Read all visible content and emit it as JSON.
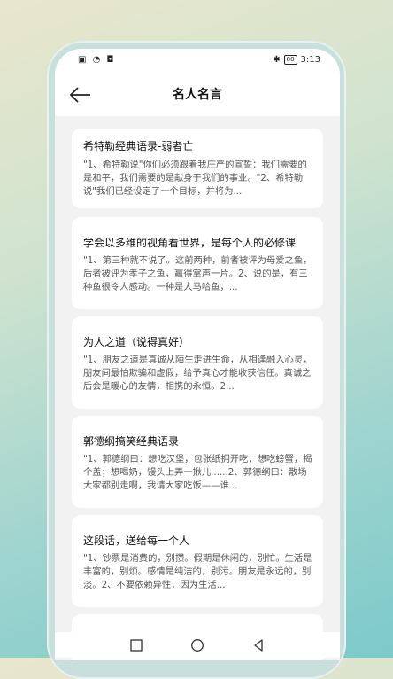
{
  "status_bar": {
    "left_icons": "▣ ◔ ◘",
    "bluetooth": "✱",
    "battery": "80",
    "time": "3:13"
  },
  "app_bar": {
    "back_icon": "arrow-left-icon",
    "title": "名人名言"
  },
  "cards": [
    {
      "title": "希特勒经典语录-弱者亡",
      "snippet": "\"1、希特勒说\"你们必须跟着我庄严的宣誓：我们需要的是和平，我们需要的是献身于我们的事业。\"2、希特勒说\"我们已经设定了一个目标，并将为..."
    },
    {
      "title": "学会以多维的视角看世界，是每个人的必修课",
      "snippet": "\"1、第三种就不说了。这前两种，前者被评为母爱之鱼，后者被评为孝子之鱼，赢得掌声一片。2、说的是，有三种鱼很令人感动。一种是大马哈鱼，..."
    },
    {
      "title": "为人之道（说得真好）",
      "snippet": "\"1、朋友之道是真诚从陌生走进生命，从相逢融入心灵，朋友间最怕欺骗和虚假，给予真心才能收获信任。真诚之后会是暖心的友情，相携的永恒。2..."
    },
    {
      "title": "郭德纲搞笑经典语录",
      "snippet": "\"1、郭德纲曰：想吃汉堡，包张纸拥开吃；想吃螃蟹，揭个盖；想喝奶，馒头上弄一揪儿......2、郭德纲曰：散场大家都别走啊，我请大家吃饭——谁..."
    },
    {
      "title": "这段话，送给每一个人",
      "snippet": "\"1、钞票是消费的，别攒。假期是休闲的，别忙。生活是丰富的，别烦。感情是纯洁的，别污。朋友是永远的，别淡。2、不要依赖异性，因为生活..."
    }
  ],
  "nav_bar": {
    "recents_icon": "square-recents-icon",
    "home_icon": "circle-home-icon",
    "back_icon": "triangle-back-icon"
  }
}
